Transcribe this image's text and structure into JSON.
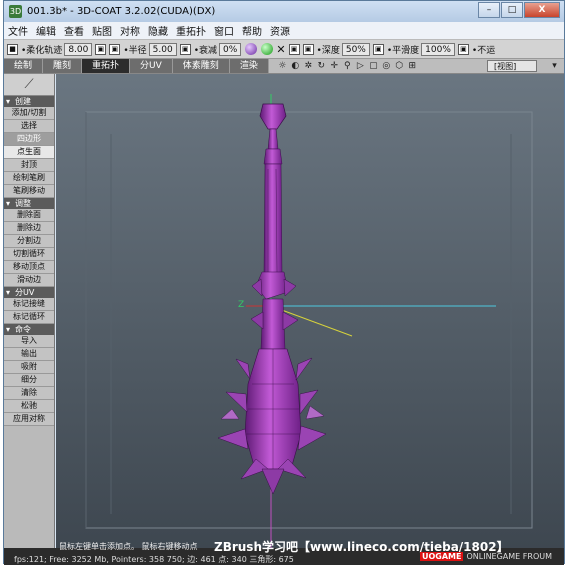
{
  "window": {
    "title": "001.3b* - 3D-COAT 3.2.02(CUDA)(DX)",
    "app_icon": "3D",
    "buttons": [
      "–",
      "□",
      "X"
    ]
  },
  "menu": [
    "文件",
    "编辑",
    "查看",
    "贴图",
    "对称",
    "隐藏",
    "重拓扑",
    "窗口",
    "帮助",
    "资源"
  ],
  "toolbar": {
    "smooth_label": "•柔化轨迹",
    "smooth_value": "8.00",
    "radius_label": "•半径",
    "radius_value": "5.00",
    "falloff_label": "•衰减",
    "falloff_value": "0%",
    "depth_label": "•深度",
    "depth_value": "50%",
    "smooth2_label": "•平滑度",
    "smooth2_value": "100%",
    "more_label": "•不运"
  },
  "tabs": [
    "绘制",
    "雕刻",
    "重拓扑",
    "分UV",
    "体素雕刻",
    "渲染"
  ],
  "active_tab": "重拓扑",
  "view_select": "[视图]",
  "sidebar": {
    "create_header": "创建",
    "create_items": [
      "添加/切割",
      "选择",
      "四边形",
      "点生面",
      "封顶",
      "绘制笔刷",
      "笔刷移动"
    ],
    "adjust_header": "调整",
    "adjust_items": [
      "删除面",
      "删除边",
      "分割边",
      "切割循环",
      "移动顶点",
      "滑动边"
    ],
    "uv_header": "分UV",
    "uv_items": [
      "标记接缝",
      "标记循环"
    ],
    "cmd_header": "命令",
    "cmd_items": [
      "导入",
      "输出",
      "吸附",
      "细分",
      "清除",
      "松驰",
      "应用对称"
    ]
  },
  "status": {
    "hint": "鼠标左键单击添加点。 鼠标右键移动点",
    "watermark": "ZBrush学习吧【www.lineco.com/tieba/1802】",
    "stats": "fps:121;    Free: 3252 Mb, Pointers: 358 750; 边: 461  点: 340   三角形: 675",
    "brand_red": "UOGAME",
    "brand_text": "ONLINEGAME FROUM"
  },
  "colors": {
    "mesh": "#b14fc4",
    "mesh_dark": "#6d1f86",
    "axis_x": "#cc3333",
    "axis_y": "#33cc66",
    "axis_z": "#4dc8e0",
    "axis_v": "#c050c0"
  }
}
